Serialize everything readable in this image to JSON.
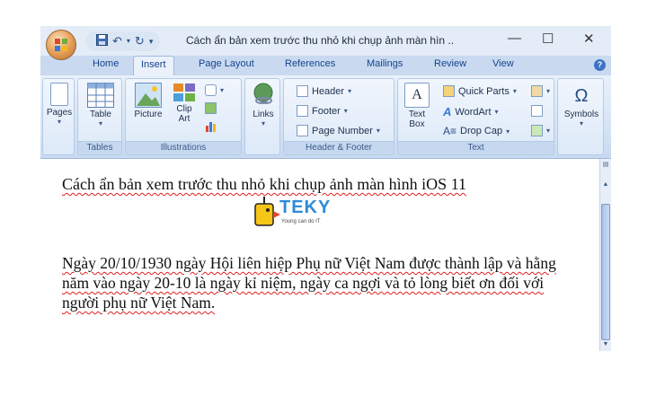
{
  "window": {
    "title": "Cách ẩn bản xem trước thu nhỏ khi chụp ảnh màn hìn ..",
    "minimize_glyph": "—",
    "maximize_glyph": "☐",
    "close_glyph": "✕"
  },
  "qat": {
    "save_icon": "save-icon",
    "undo_icon": "undo-icon",
    "redo_icon": "redo-icon",
    "customize_glyph": "▾"
  },
  "tabs": [
    "Home",
    "Insert",
    "Page Layout",
    "References",
    "Mailings",
    "Review",
    "View"
  ],
  "active_tab": "Insert",
  "ribbon": {
    "pages": {
      "label": "Pages"
    },
    "tables": {
      "table_label": "Table",
      "group_label": "Tables"
    },
    "illustrations": {
      "picture_label": "Picture",
      "clipart_label": "Clip Art",
      "group_label": "Illustrations"
    },
    "links": {
      "label": "Links"
    },
    "header_footer": {
      "header_label": "Header",
      "footer_label": "Footer",
      "page_number_label": "Page Number",
      "group_label": "Header & Footer"
    },
    "text": {
      "textbox_label": "Text Box",
      "quick_parts_label": "Quick Parts",
      "wordart_label": "WordArt",
      "drop_cap_label": "Drop Cap",
      "group_label": "Text"
    },
    "symbols": {
      "symbol_glyph": "Ω",
      "label": "Symbols"
    }
  },
  "document": {
    "title_line": "Cách ẩn bản xem trước thu nhỏ khi chụp ảnh màn hình iOS 11",
    "logo_text": "TEKY",
    "logo_tagline": "Young can do IT",
    "paragraph": "Ngày 20/10/1930 ngày Hội liên hiệp Phụ nữ Việt Nam được thành lập và hằng năm vào ngày 20-10 là ngày kỉ niệm, ngày ca ngợi và tỏ lòng biết ơn đối với người phụ nữ Việt Nam."
  },
  "colors": {
    "ribbon_blue": "#c9daf0",
    "tab_text": "#15428b",
    "spell_underline": "#e02020",
    "teky_blue": "#2e8bd8",
    "teky_yellow": "#f5c518"
  }
}
